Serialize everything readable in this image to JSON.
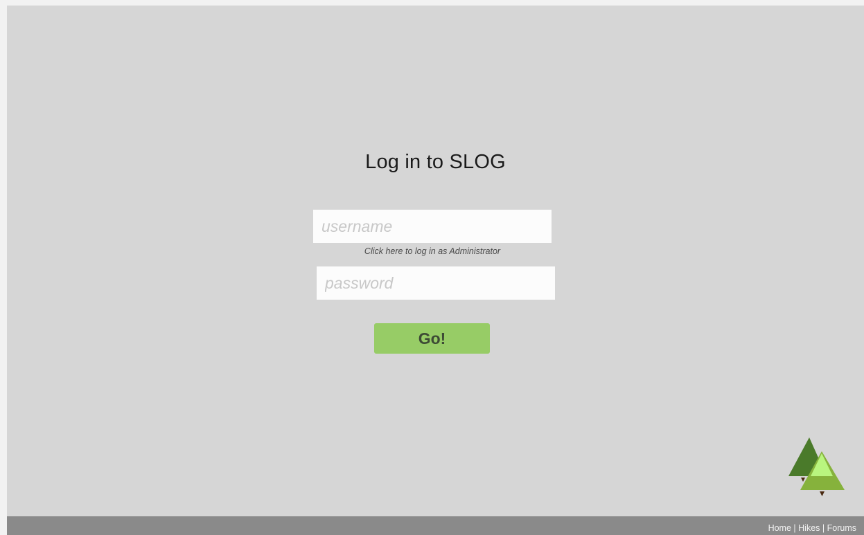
{
  "login": {
    "title": "Log in to SLOG",
    "username_placeholder": "username",
    "admin_link": "Click here to log in as Administrator",
    "password_placeholder": "password",
    "go_label": "Go!"
  },
  "footer": {
    "links": [
      "Home",
      "Hikes",
      "Forums"
    ],
    "separator": "|"
  },
  "colors": {
    "background": "#d6d6d6",
    "input_background": "#fcfcfc",
    "go_button": "#97cc66",
    "footer": "#8a8a8a",
    "logo_tree_dark": "#4a7a2a",
    "logo_tree_mid": "#86b23c",
    "logo_tree_light": "#b9f57f",
    "logo_trunk": "#4a2a10"
  },
  "icons": {
    "logo": "pine-trees-icon"
  }
}
